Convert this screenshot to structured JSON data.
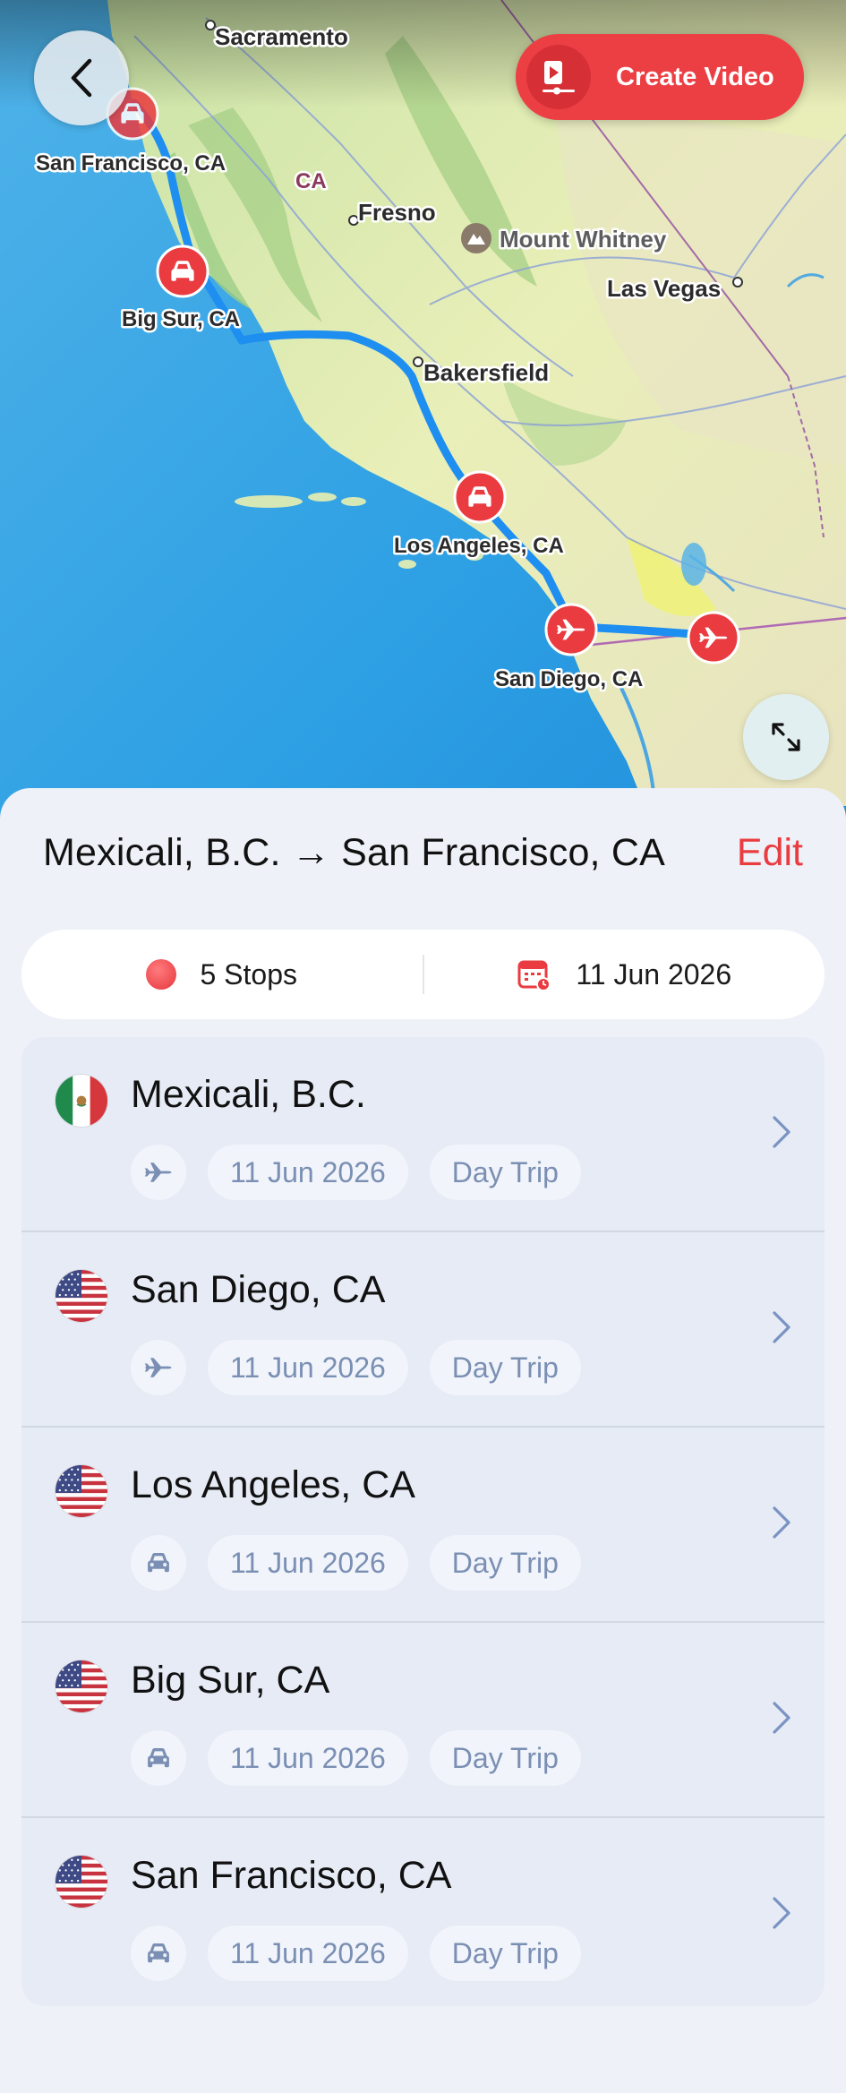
{
  "header": {
    "back_icon": "chevron-left-icon",
    "create_video_label": "Create Video",
    "create_video_icon": "video-play-icon",
    "expand_icon": "expand-arrows-icon"
  },
  "map": {
    "labels": {
      "sacramento": "Sacramento",
      "san_francisco": "San Francisco, CA",
      "ca": "CA",
      "fresno": "Fresno",
      "mount_whitney": "Mount Whitney",
      "las_vegas": "Las Vegas",
      "big_sur": "Big Sur, CA",
      "bakersfield": "Bakersfield",
      "los_angeles": "Los Angeles, CA",
      "san_diego": "San Diego, CA"
    },
    "route_color": "#1e8ff0",
    "marker_color": "#ea3b40"
  },
  "trip": {
    "title": "Mexicali, B.C. → San Francisco, CA",
    "edit_label": "Edit",
    "stops_label": "5 Stops",
    "date_label": "11 Jun 2026"
  },
  "stops": [
    {
      "name": "Mexicali, B.C.",
      "flag": "mexico-flag",
      "mode": "plane-icon",
      "date": "11 Jun 2026",
      "duration": "Day Trip"
    },
    {
      "name": "San Diego, CA",
      "flag": "usa-flag",
      "mode": "plane-icon",
      "date": "11 Jun 2026",
      "duration": "Day Trip"
    },
    {
      "name": "Los Angeles, CA",
      "flag": "usa-flag",
      "mode": "car-icon",
      "date": "11 Jun 2026",
      "duration": "Day Trip"
    },
    {
      "name": "Big Sur, CA",
      "flag": "usa-flag",
      "mode": "car-icon",
      "date": "11 Jun 2026",
      "duration": "Day Trip"
    },
    {
      "name": "San Francisco, CA",
      "flag": "usa-flag",
      "mode": "car-icon",
      "date": "11 Jun 2026",
      "duration": "Day Trip"
    }
  ],
  "colors": {
    "accent": "#ea3b40",
    "pill_text": "#7a8fb3",
    "list_bg": "#e6ebf5"
  }
}
